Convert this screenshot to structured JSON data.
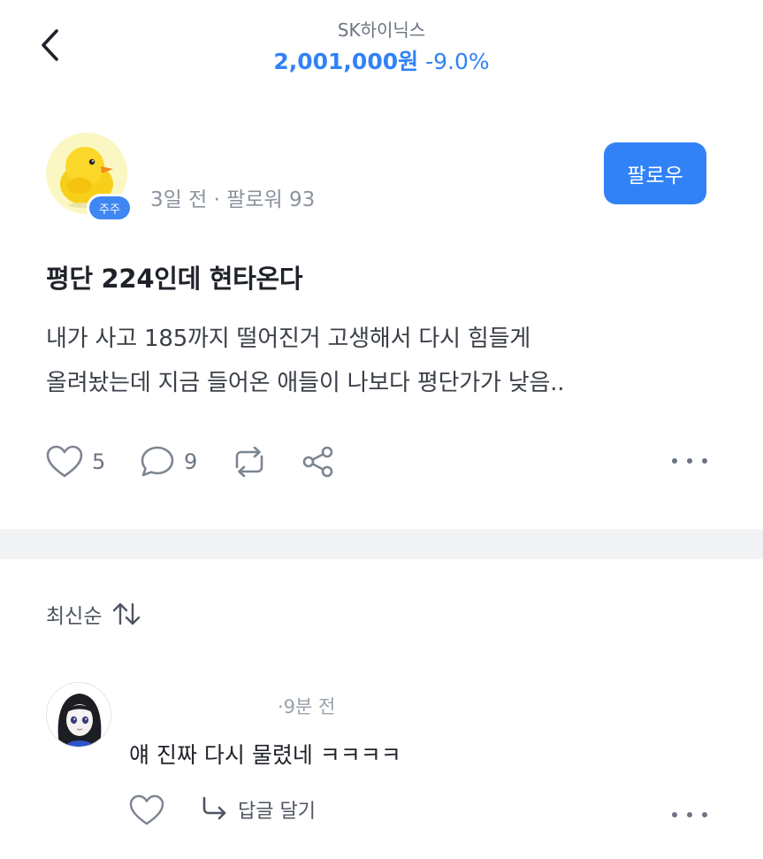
{
  "header": {
    "stock_name": "SK하이닉스",
    "price": "2,001,000원",
    "change": "-9.0%",
    "price_color": "#3182f6"
  },
  "post": {
    "author_badge": "주주",
    "meta": "3일 전 · 팔로워 93",
    "follow_label": "팔로우",
    "title": "평단 224인데 현타온다",
    "body_line1": "내가 사고 185까지 떨어진거 고생해서 다시 힘들게",
    "body_line2": "올려놨는데 지금 들어온 애들이 나보다 평단가가 낮음..",
    "likes": "5",
    "comments": "9"
  },
  "sort": {
    "label": "최신순"
  },
  "comment": {
    "meta": "·9분 전",
    "text": "얘 진짜 다시 물렸네 ㅋㅋㅋㅋ",
    "reply_label": "답글 달기"
  },
  "colors": {
    "accent": "#3182f6",
    "divider": "#f2f3f5"
  }
}
